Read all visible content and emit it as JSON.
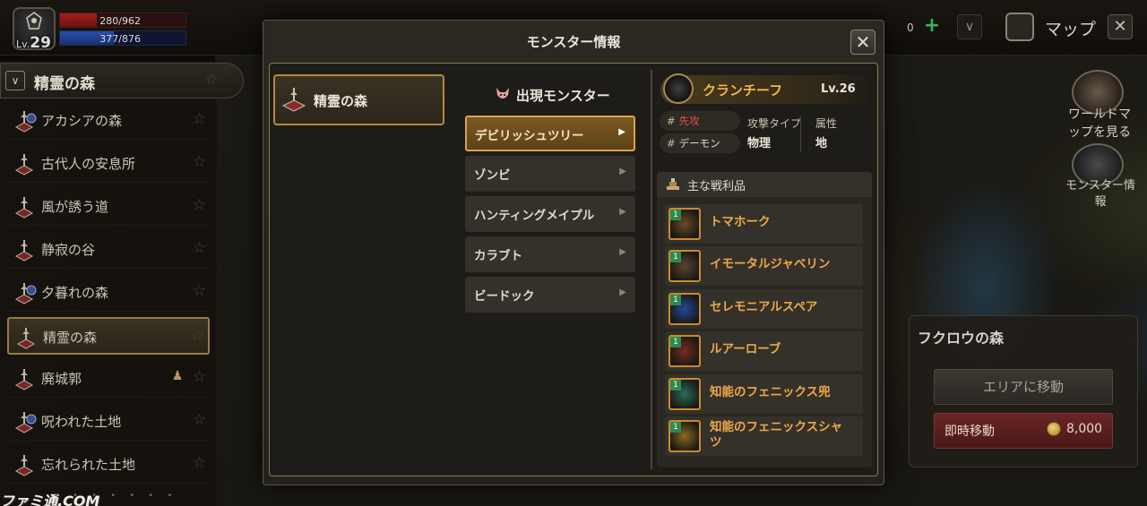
{
  "player": {
    "level_prefix": "Lv.",
    "level": "29",
    "hp_text": "280/962",
    "hp_fraction": 0.29,
    "mp_text": "377/876",
    "mp_fraction": 0.43
  },
  "topbar": {
    "count": "0",
    "map_label": "マップ"
  },
  "sidebar": {
    "header": "精霊の森",
    "items": [
      {
        "label": "アカシアの森",
        "icon": "town-region-icon",
        "active": false,
        "boss": false
      },
      {
        "label": "古代人の安息所",
        "icon": "field-region-icon",
        "active": false,
        "boss": false
      },
      {
        "label": "風が誘う道",
        "icon": "field-region-icon",
        "active": false,
        "boss": false
      },
      {
        "label": "静寂の谷",
        "icon": "field-region-icon",
        "active": false,
        "boss": false
      },
      {
        "label": "夕暮れの森",
        "icon": "town-region-icon",
        "active": false,
        "boss": false
      },
      {
        "label": "精霊の森",
        "icon": "field-region-icon",
        "active": true,
        "boss": false
      },
      {
        "label": "廃城郭",
        "icon": "field-region-icon",
        "active": false,
        "boss": true
      },
      {
        "label": "呪われた土地",
        "icon": "town-region-icon",
        "active": false,
        "boss": false
      },
      {
        "label": "忘れられた土地",
        "icon": "field-region-icon",
        "active": false,
        "boss": false
      }
    ]
  },
  "right_menu": {
    "world_map": "ワールドマップを見る",
    "world_map_line1": "ワールドマ",
    "world_map_line2": "ップを見る",
    "monster_info_line1": "モンスター情",
    "monster_info_line2": "報"
  },
  "travel": {
    "title": "フクロウの森",
    "move_button": "エリアに移動",
    "instant_button": "即時移動",
    "cost": "8,000"
  },
  "modal": {
    "title": "モンスター情報",
    "area_tab": "精霊の森",
    "monsters_header": "出現モンスター",
    "monsters": [
      {
        "name": "デビリッシュツリー",
        "selected": true
      },
      {
        "name": "ゾンビ",
        "selected": false
      },
      {
        "name": "ハンティングメイプル",
        "selected": false
      },
      {
        "name": "カラブト",
        "selected": false
      },
      {
        "name": "ビードック",
        "selected": false
      }
    ],
    "detail": {
      "boss_name": "クランチーフ",
      "boss_level": "Lv.26",
      "tag_aggressive": "先攻",
      "tag_type": "デーモン",
      "attack_type_label": "攻撃タイプ",
      "attack_type_value": "物理",
      "attribute_label": "属性",
      "attribute_value": "地",
      "loot_header": "主な戦利品",
      "loot": [
        {
          "name": "トマホーク",
          "grade": "1",
          "color": "#6b4a2a",
          "two_line": false
        },
        {
          "name": "イモータルジャベリン",
          "grade": "1",
          "color": "#5a4530",
          "two_line": false
        },
        {
          "name": "セレモニアルスペア",
          "grade": "1",
          "color": "#1f4a9a",
          "two_line": false
        },
        {
          "name": "ルアーローブ",
          "grade": "1",
          "color": "#7a2a22",
          "two_line": false
        },
        {
          "name": "知能のフェニックス兜",
          "grade": "1",
          "color": "#2a6a5a",
          "two_line": false
        },
        {
          "name": "知能のフェニックスシャツ",
          "grade": "1",
          "color": "#8a6a22",
          "two_line": true
        }
      ]
    }
  },
  "watermark": "ファミ通.COM",
  "colors": {
    "accent_gold": "#f4b646",
    "loot_orange": "#f0a848",
    "selected_border": "#d9a44a",
    "hp_red": "#a21d1d",
    "mp_blue": "#2b4ea8"
  }
}
